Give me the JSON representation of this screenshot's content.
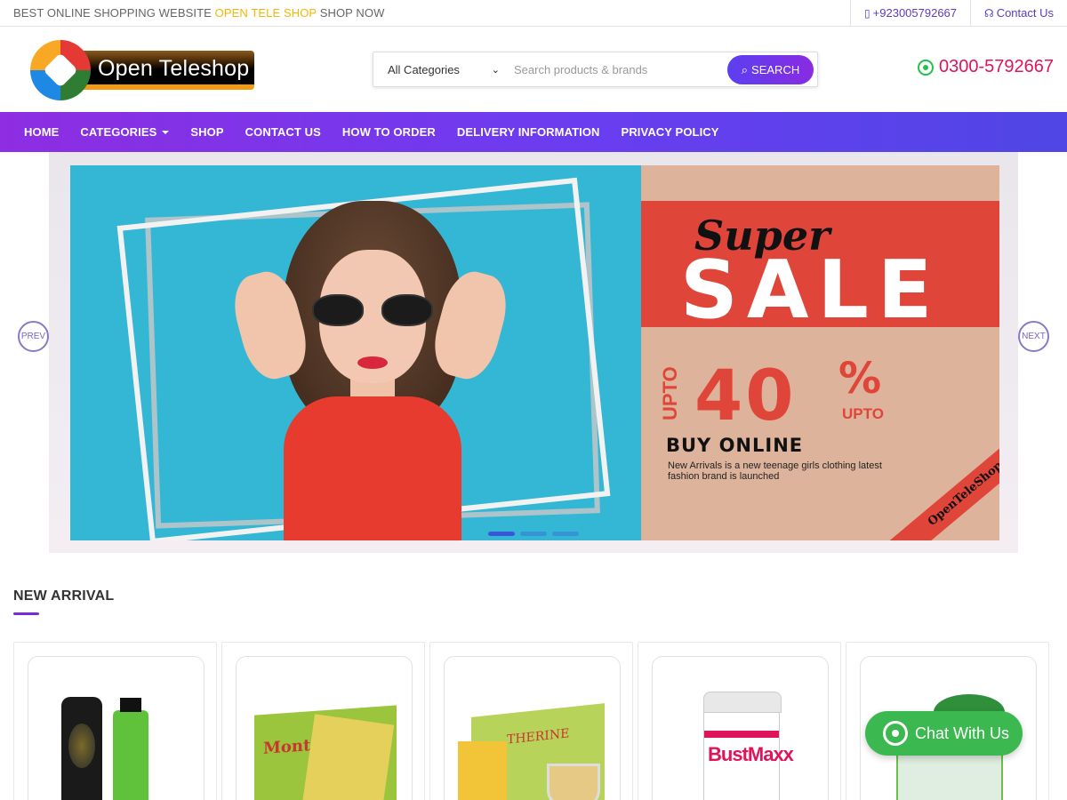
{
  "topbar": {
    "text_prefix": "BEST ONLINE SHOPPING WEBSITE",
    "text_highlight": "OPEN TELE SHOP",
    "text_suffix": "SHOP NOW",
    "phone": "+923005792667",
    "contact": "Contact Us"
  },
  "header": {
    "logo_text": "Open Teleshop",
    "search_category": "All Categories",
    "search_placeholder": "Search products & brands",
    "search_button": "SEARCH",
    "whatsapp_number": "0300-5792667"
  },
  "nav": {
    "items": [
      "HOME",
      "CATEGORIES",
      "SHOP",
      "CONTACT US",
      "HOW TO ORDER",
      "DELIVERY INFORMATION",
      "PRIVACY POLICY"
    ]
  },
  "banner": {
    "super": "Super",
    "sale": "SALE",
    "upto_vertical": "UPTO",
    "percent": "40",
    "percent_sign": "%",
    "upto": "UPTO",
    "buy_online": "BUY ONLINE",
    "description": "New Arrivals is a new teenage girls clothing latest fashion brand is launched",
    "ribbon": "OpenTeleShop",
    "prev": "PREV",
    "next": "NEXT",
    "slide_count": 3,
    "active_slide": 1
  },
  "new_arrival": {
    "title": "NEW ARRIVAL",
    "product_labels": [
      "Monta",
      "THERINE",
      "BustMaxx"
    ]
  },
  "chat": {
    "label": "Chat With Us"
  },
  "colors": {
    "accent": "#7a2ad8",
    "highlight": "#f2b705",
    "phone_color": "#e0145b",
    "whatsapp": "#3bb84f"
  }
}
